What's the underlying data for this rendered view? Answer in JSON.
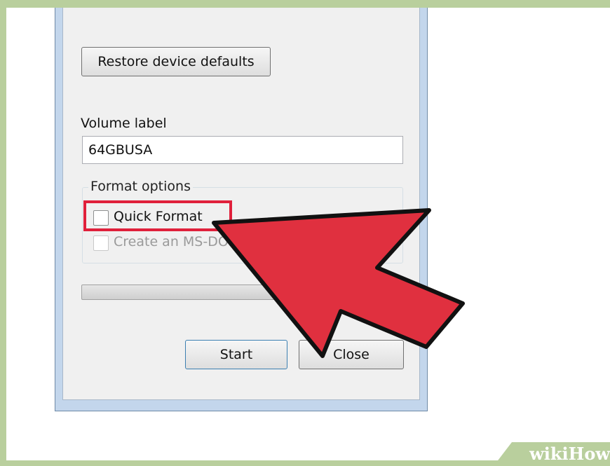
{
  "dialog": {
    "restore_button_label": "Restore device defaults",
    "volume_label_caption": "Volume label",
    "volume_label_value": "64GBUSA",
    "format_options_title": "Format options",
    "quick_format_label": "Quick Format",
    "quick_format_checked": false,
    "msdos_label": "Create an MS-DOS startup disk",
    "msdos_enabled": false,
    "progress": 0,
    "start_button_label": "Start",
    "close_button_label": "Close"
  },
  "annotation": {
    "highlight_color": "#e0203b",
    "arrow_color": "#e0303f",
    "highlight_target": "quick-format-checkbox"
  },
  "watermark": {
    "wiki": "wiki",
    "how": "How"
  },
  "colors": {
    "frame": "#b9cf9d",
    "window_border": "#c3d6ec",
    "dialog_bg": "#f0f0f0"
  }
}
